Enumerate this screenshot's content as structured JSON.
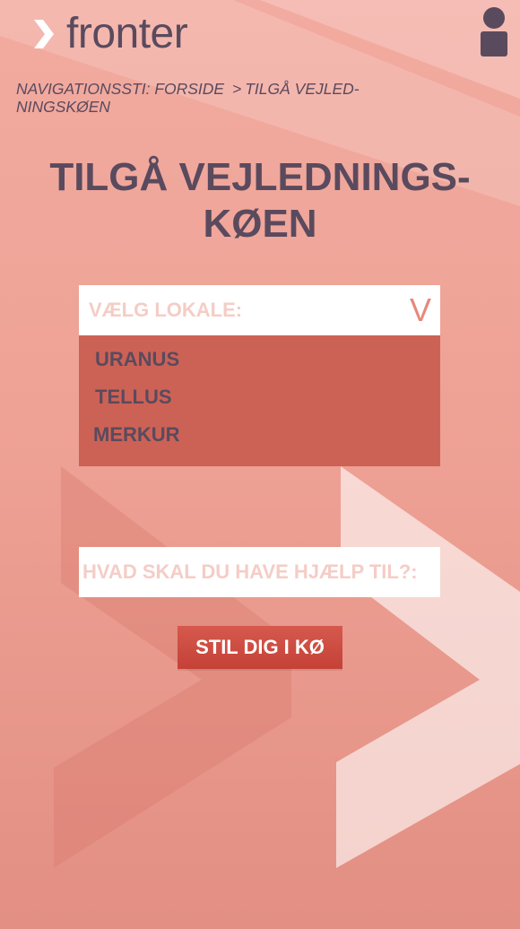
{
  "header": {
    "logo_text": "fronter",
    "user_icon": "user-icon"
  },
  "breadcrumb": {
    "prefix": "NAVIGATIONSSTI:",
    "items": [
      "FORSIDE",
      "TILGÅ VEJLED-NINGSKØEN"
    ],
    "separator": ">"
  },
  "page": {
    "title_line1": "TILGÅ VEJLEDNINGS-",
    "title_line2": "KØEN"
  },
  "room_select": {
    "placeholder": "VÆLG LOKALE:",
    "chevron": "V",
    "options": [
      "URANUS",
      "TELLUS",
      "MERKUR"
    ]
  },
  "help_field": {
    "placeholder": "HVAD SKAL DU HAVE HJÆLP TIL?:",
    "value": ""
  },
  "submit": {
    "label": "STIL DIG I KØ"
  },
  "colors": {
    "text": "#5a4a5e",
    "options_bg": "#cc6255",
    "button": "#c44137",
    "placeholder": "#f4cdc6",
    "chevron": "#e8877b"
  }
}
